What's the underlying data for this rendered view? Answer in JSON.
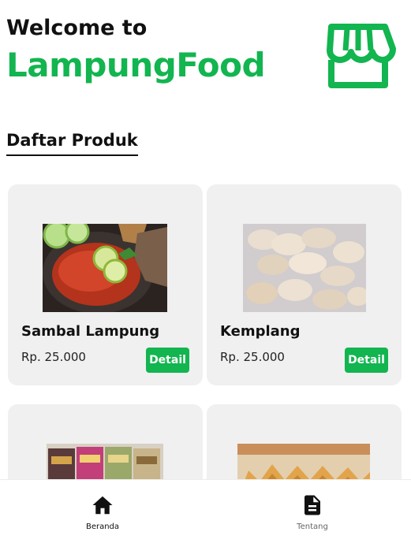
{
  "header": {
    "welcome": "Welcome to",
    "brand": "LampungFood",
    "store_icon": "store-icon"
  },
  "section": {
    "title": "Daftar Produk"
  },
  "products": [
    {
      "name": "Sambal Lampung",
      "price": "Rp. 25.000",
      "button": "Detail"
    },
    {
      "name": "Kemplang",
      "price": "Rp. 25.000",
      "button": "Detail"
    },
    {
      "name": "",
      "price": "",
      "button": ""
    },
    {
      "name": "",
      "price": "",
      "button": ""
    }
  ],
  "bottom_nav": {
    "items": [
      {
        "label": "Beranda",
        "icon": "home-icon",
        "active": true
      },
      {
        "label": "Tentang",
        "icon": "document-icon",
        "active": false
      }
    ]
  },
  "colors": {
    "brand": "#12b54f",
    "card_bg": "#f0f0f0"
  }
}
